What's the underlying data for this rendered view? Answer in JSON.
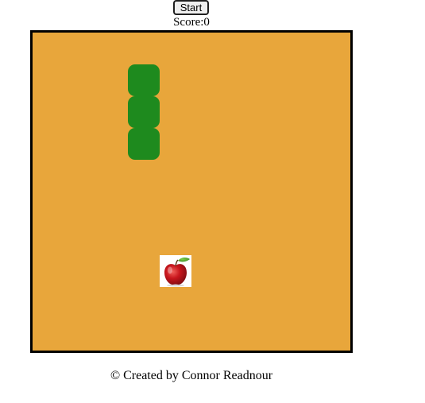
{
  "controls": {
    "start_label": "Start"
  },
  "score": {
    "label": "Score:",
    "value": 0
  },
  "board": {
    "cols": 10,
    "rows": 10,
    "background_color": "#E8A63B",
    "border_color": "#000000",
    "snake_color": "#1E8A1E"
  },
  "snake": {
    "direction": "up",
    "segments": [
      {
        "col": 3,
        "row": 1
      },
      {
        "col": 3,
        "row": 2
      },
      {
        "col": 3,
        "row": 3
      }
    ]
  },
  "food": {
    "icon": "apple-icon",
    "col": 4,
    "row": 7
  },
  "footer": {
    "text": "© Created by Connor Readnour"
  }
}
